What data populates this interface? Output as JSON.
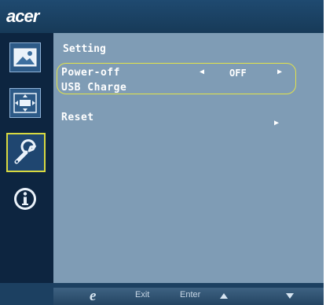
{
  "brand": "acer",
  "sidebar": {
    "items": [
      {
        "name": "picture",
        "icon": "picture-icon",
        "selected": false
      },
      {
        "name": "display",
        "icon": "display-position-icon",
        "selected": false
      },
      {
        "name": "setting",
        "icon": "wrench-icon",
        "selected": true
      },
      {
        "name": "information",
        "icon": "info-icon",
        "selected": false
      }
    ]
  },
  "panel": {
    "title": "Setting",
    "rows": [
      {
        "label": "Power-off",
        "value": "OFF"
      },
      {
        "label": "USB Charge"
      },
      {
        "label": "Reset"
      }
    ]
  },
  "bottom_bar": {
    "exit_label": "Exit",
    "enter_label": "Enter",
    "icons": [
      "e-key-icon",
      "up-arrow-icon",
      "down-arrow-icon"
    ]
  },
  "colors": {
    "panel": "#7f9cb5",
    "sidebar": "#0d2540",
    "highlight": "#e3e34a",
    "frame": "#1c4061"
  }
}
